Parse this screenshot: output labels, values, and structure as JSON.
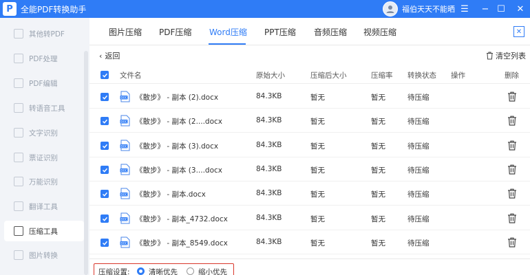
{
  "app": {
    "logo_letter": "P",
    "title": "全能PDF转换助手",
    "user_name": "福伯天天不能晒",
    "window_controls": [
      "☰",
      "−",
      "☐",
      "✕"
    ]
  },
  "sidebar": {
    "items": [
      {
        "label": "其他转PDF",
        "icon": "convert-icon",
        "active": false
      },
      {
        "label": "PDF处理",
        "icon": "pdf-process-icon",
        "active": false
      },
      {
        "label": "PDF编辑",
        "icon": "pdf-edit-icon",
        "active": false
      },
      {
        "label": "转语音工具",
        "icon": "voice-icon",
        "active": false
      },
      {
        "label": "文字识别",
        "icon": "ocr-icon",
        "active": false
      },
      {
        "label": "票证识别",
        "icon": "ticket-icon",
        "active": false
      },
      {
        "label": "万能识别",
        "icon": "scan-icon",
        "active": false
      },
      {
        "label": "翻译工具",
        "icon": "translate-icon",
        "active": false
      },
      {
        "label": "压缩工具",
        "icon": "compress-icon",
        "active": true
      },
      {
        "label": "图片转换",
        "icon": "image-convert-icon",
        "active": false
      }
    ]
  },
  "tabs": [
    {
      "label": "图片压缩",
      "active": false
    },
    {
      "label": "PDF压缩",
      "active": false
    },
    {
      "label": "Word压缩",
      "active": true
    },
    {
      "label": "PPT压缩",
      "active": false
    },
    {
      "label": "音频压缩",
      "active": false
    },
    {
      "label": "视频压缩",
      "active": false
    }
  ],
  "panel_close": "✕",
  "toolbar": {
    "back_label": "返回",
    "clear_label": "清空列表"
  },
  "table": {
    "headers": {
      "filename": "文件名",
      "original_size": "原始大小",
      "compressed_size": "压缩后大小",
      "ratio": "压缩率",
      "status": "转换状态",
      "action": "操作",
      "delete": "删除"
    },
    "rows": [
      {
        "name": "《散步》 - 副本 (2).docx",
        "original": "84.3KB",
        "compressed": "暂无",
        "ratio": "暂无",
        "status": "待压缩",
        "checked": true
      },
      {
        "name": "《散步》 - 副本 (2....docx",
        "original": "84.3KB",
        "compressed": "暂无",
        "ratio": "暂无",
        "status": "待压缩",
        "checked": true
      },
      {
        "name": "《散步》 - 副本 (3).docx",
        "original": "84.3KB",
        "compressed": "暂无",
        "ratio": "暂无",
        "status": "待压缩",
        "checked": true
      },
      {
        "name": "《散步》 - 副本 (3....docx",
        "original": "84.3KB",
        "compressed": "暂无",
        "ratio": "暂无",
        "status": "待压缩",
        "checked": true
      },
      {
        "name": "《散步》 - 副本.docx",
        "original": "84.3KB",
        "compressed": "暂无",
        "ratio": "暂无",
        "status": "待压缩",
        "checked": true
      },
      {
        "name": "《散步》 - 副本_4732.docx",
        "original": "84.3KB",
        "compressed": "暂无",
        "ratio": "暂无",
        "status": "待压缩",
        "checked": true
      },
      {
        "name": "《散步》 - 副本_8549.docx",
        "original": "84.3KB",
        "compressed": "暂无",
        "ratio": "暂无",
        "status": "待压缩",
        "checked": true
      }
    ]
  },
  "settings": {
    "label": "压缩设置:",
    "options": [
      {
        "label": "清晰优先",
        "selected": true
      },
      {
        "label": "缩小优先",
        "selected": false
      }
    ]
  },
  "colors": {
    "accent": "#2f7cf6",
    "highlight_border": "#d9362b"
  }
}
